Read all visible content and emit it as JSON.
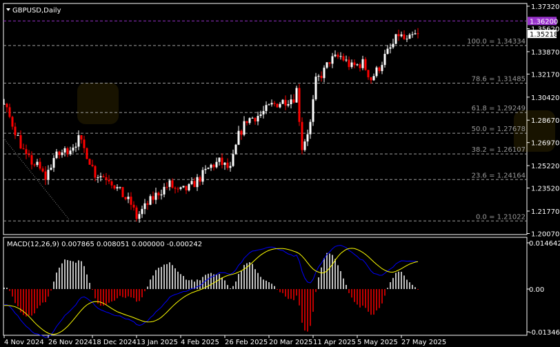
{
  "symbol_title": "GBPUSD,Daily",
  "macd_label": "MACD(12,26,9) 0.007865 0.008051 0.000000 -0.000242",
  "price_axis": [
    "1.37320",
    "1.35620",
    "1.33870",
    "1.32170",
    "1.30420",
    "1.28670",
    "1.26970",
    "1.25220",
    "1.23520",
    "1.21770",
    "1.20070"
  ],
  "price_axis_values": [
    1.3732,
    1.3562,
    1.3387,
    1.3217,
    1.3042,
    1.2867,
    1.2697,
    1.2522,
    1.2352,
    1.2177,
    1.2007
  ],
  "alert_level": {
    "label": "1.36200",
    "value": 1.362,
    "color": "#9932cc"
  },
  "current_price": {
    "label": "1.35218",
    "value": 1.35218
  },
  "fibonacci": [
    {
      "text": "100.0 = 1.34334",
      "value": 1.34334
    },
    {
      "text": "78.6 = 1.31485",
      "value": 1.31485
    },
    {
      "text": "61.8 = 1.29249",
      "value": 1.29249
    },
    {
      "text": "50.0 = 1.27678",
      "value": 1.27678
    },
    {
      "text": "38.2 = 1.26107",
      "value": 1.26107
    },
    {
      "text": "23.6 = 1.24164",
      "value": 1.24164
    },
    {
      "text": "0.0 = 1.21022",
      "value": 1.21022
    }
  ],
  "macd_axis": [
    {
      "label": "0.014642",
      "value": 0.014642
    },
    {
      "label": "0.00",
      "value": 0
    },
    {
      "label": "-0.013461",
      "value": -0.013461
    }
  ],
  "date_axis": [
    {
      "label": "4 Nov 2024",
      "bar": 0
    },
    {
      "label": "26 Nov 2024",
      "bar": 16
    },
    {
      "label": "18 Dec 2024",
      "bar": 32
    },
    {
      "label": "13 Jan 2025",
      "bar": 48
    },
    {
      "label": "4 Feb 2025",
      "bar": 64
    },
    {
      "label": "26 Feb 2025",
      "bar": 80
    },
    {
      "label": "20 Mar 2025",
      "bar": 96
    },
    {
      "label": "11 Apr 2025",
      "bar": 112
    },
    {
      "label": "5 May 2025",
      "bar": 128
    },
    {
      "label": "27 May 2025",
      "bar": 144
    }
  ],
  "colors": {
    "bull": "#ffffff",
    "bear": "#ff0000",
    "macd_main": "#0000ff",
    "macd_signal": "#ffff00",
    "grid": "#a0a0a0"
  },
  "price_keypoints": [
    [
      -40,
      1.335
    ],
    [
      -20,
      1.31
    ],
    [
      0,
      1.298
    ],
    [
      3,
      1.284
    ],
    [
      8,
      1.258
    ],
    [
      12,
      1.252
    ],
    [
      15,
      1.243
    ],
    [
      18,
      1.258
    ],
    [
      24,
      1.266
    ],
    [
      27,
      1.272
    ],
    [
      30,
      1.261
    ],
    [
      33,
      1.246
    ],
    [
      38,
      1.243
    ],
    [
      42,
      1.232
    ],
    [
      46,
      1.223
    ],
    [
      48,
      1.213
    ],
    [
      52,
      1.223
    ],
    [
      56,
      1.232
    ],
    [
      60,
      1.238
    ],
    [
      63,
      1.232
    ],
    [
      67,
      1.235
    ],
    [
      71,
      1.243
    ],
    [
      75,
      1.252
    ],
    [
      78,
      1.255
    ],
    [
      82,
      1.249
    ],
    [
      85,
      1.275
    ],
    [
      88,
      1.287
    ],
    [
      93,
      1.291
    ],
    [
      97,
      1.298
    ],
    [
      101,
      1.301
    ],
    [
      105,
      1.304
    ],
    [
      106,
      1.31
    ],
    [
      108,
      1.266
    ],
    [
      111,
      1.284
    ],
    [
      113,
      1.316
    ],
    [
      116,
      1.324
    ],
    [
      118,
      1.332
    ],
    [
      122,
      1.335
    ],
    [
      126,
      1.327
    ],
    [
      130,
      1.33
    ],
    [
      133,
      1.318
    ],
    [
      136,
      1.327
    ],
    [
      138,
      1.335
    ],
    [
      141,
      1.344
    ],
    [
      143,
      1.352
    ],
    [
      146,
      1.346
    ],
    [
      148,
      1.35
    ],
    [
      150,
      1.3522
    ]
  ]
}
